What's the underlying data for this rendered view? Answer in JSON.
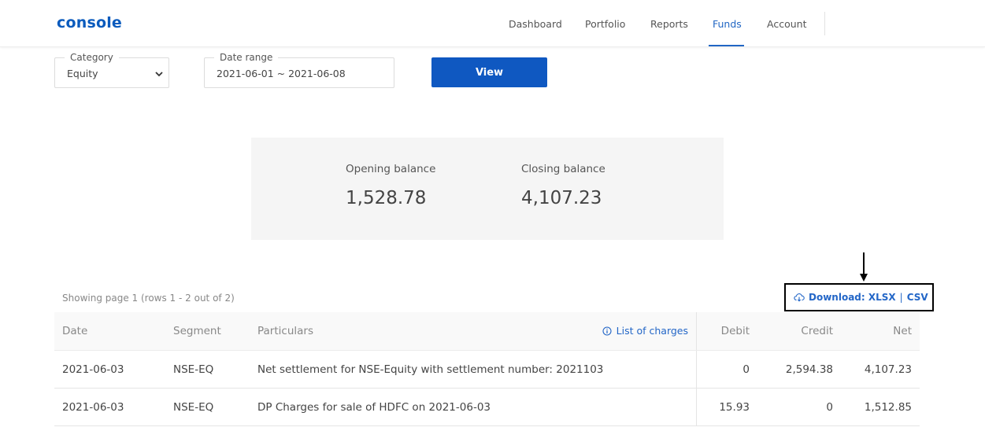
{
  "app": {
    "logo": "console"
  },
  "nav": {
    "items": [
      {
        "label": "Dashboard"
      },
      {
        "label": "Portfolio"
      },
      {
        "label": "Reports"
      },
      {
        "label": "Funds",
        "active": true
      },
      {
        "label": "Account"
      }
    ]
  },
  "filters": {
    "category": {
      "label": "Category",
      "value": "Equity"
    },
    "date_range": {
      "label": "Date range",
      "value": "2021-06-01 ~ 2021-06-08"
    },
    "view_label": "View"
  },
  "balance": {
    "opening_label": "Opening balance",
    "opening_value": "1,528.78",
    "closing_label": "Closing balance",
    "closing_value": "4,107.23"
  },
  "download": {
    "prefix": "Download:",
    "xlsx": "XLSX",
    "separator": "|",
    "csv": "CSV"
  },
  "pagination": {
    "text": "Showing page 1 (rows 1 - 2 out of 2)"
  },
  "table": {
    "headers": {
      "date": "Date",
      "segment": "Segment",
      "particulars": "Particulars",
      "charges_link": "List of charges",
      "debit": "Debit",
      "credit": "Credit",
      "net": "Net"
    },
    "rows": [
      {
        "date": "2021-06-03",
        "segment": "NSE-EQ",
        "particulars": "Net settlement for NSE-Equity with settlement number: 2021103",
        "debit": "0",
        "credit": "2,594.38",
        "net": "4,107.23"
      },
      {
        "date": "2021-06-03",
        "segment": "NSE-EQ",
        "particulars": "DP Charges for sale of HDFC on 2021-06-03",
        "debit": "15.93",
        "credit": "0",
        "net": "1,512.85"
      }
    ]
  },
  "colors": {
    "brand": "#0b5bbd",
    "primary_button": "#0f58c1",
    "link": "#2366c7"
  },
  "icons": [
    "chevron-down-icon",
    "cloud-download-icon",
    "info-icon"
  ]
}
